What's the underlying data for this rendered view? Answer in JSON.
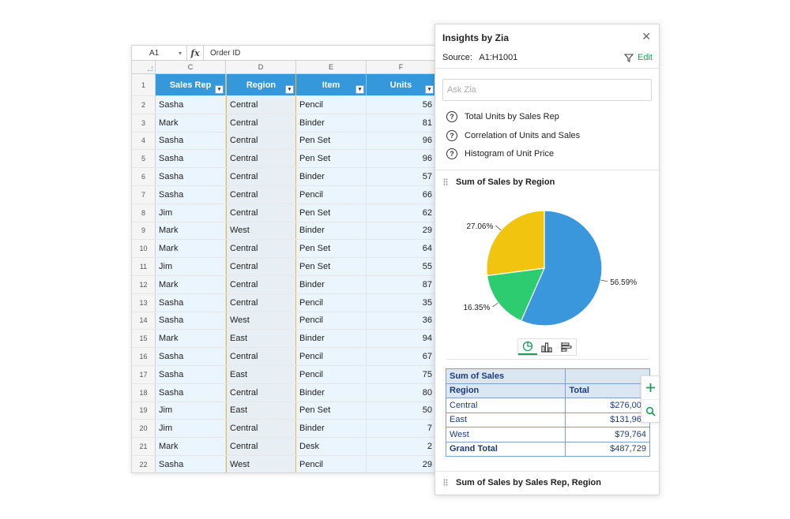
{
  "formula_bar": {
    "cell_ref": "A1",
    "fx": "fx",
    "value": "Order ID"
  },
  "columns": [
    "C",
    "D",
    "E",
    "F"
  ],
  "header_row": {
    "num": "1",
    "cells": [
      "Sales Rep",
      "Region",
      "Item",
      "Units"
    ]
  },
  "rows": [
    [
      "2",
      "Sasha",
      "Central",
      "Pencil",
      "56"
    ],
    [
      "3",
      "Mark",
      "Central",
      "Binder",
      "81"
    ],
    [
      "4",
      "Sasha",
      "Central",
      "Pen Set",
      "96"
    ],
    [
      "5",
      "Sasha",
      "Central",
      "Pen Set",
      "96"
    ],
    [
      "6",
      "Sasha",
      "Central",
      "Binder",
      "57"
    ],
    [
      "7",
      "Sasha",
      "Central",
      "Pencil",
      "66"
    ],
    [
      "8",
      "Jim",
      "Central",
      "Pen Set",
      "62"
    ],
    [
      "9",
      "Mark",
      "West",
      "Binder",
      "29"
    ],
    [
      "10",
      "Mark",
      "Central",
      "Pen Set",
      "64"
    ],
    [
      "11",
      "Jim",
      "Central",
      "Pen Set",
      "55"
    ],
    [
      "12",
      "Mark",
      "Central",
      "Binder",
      "87"
    ],
    [
      "13",
      "Sasha",
      "Central",
      "Pencil",
      "35"
    ],
    [
      "14",
      "Sasha",
      "West",
      "Pencil",
      "36"
    ],
    [
      "15",
      "Mark",
      "East",
      "Binder",
      "94"
    ],
    [
      "16",
      "Sasha",
      "Central",
      "Pencil",
      "67"
    ],
    [
      "17",
      "Sasha",
      "East",
      "Pencil",
      "75"
    ],
    [
      "18",
      "Sasha",
      "Central",
      "Binder",
      "80"
    ],
    [
      "19",
      "Jim",
      "East",
      "Pen Set",
      "50"
    ],
    [
      "20",
      "Jim",
      "Central",
      "Binder",
      "7"
    ],
    [
      "21",
      "Mark",
      "Central",
      "Desk",
      "2"
    ],
    [
      "22",
      "Sasha",
      "West",
      "Pencil",
      "29"
    ]
  ],
  "panel": {
    "title": "Insights by Zia",
    "close_icon": "close-icon",
    "source_label": "Source:",
    "source_range": "A1:H1001",
    "edit_label": "Edit",
    "ask_placeholder": "Ask Zia",
    "suggestions": [
      "Total Units by Sales Rep",
      "Correlation of Units and Sales",
      "Histogram of Unit Price"
    ],
    "card1_title": "Sum of Sales by Region",
    "card2_title": "Sum of Sales by Sales Rep, Region"
  },
  "chart_data": {
    "type": "pie",
    "slices": [
      {
        "value": 56.59,
        "label": "56.59%",
        "color": "#3b97dc"
      },
      {
        "value": 16.35,
        "label": "16.35%",
        "color": "#2ecc71"
      },
      {
        "value": 27.06,
        "label": "27.06%",
        "color": "#f1c40f"
      }
    ]
  },
  "pivot": {
    "title": "Sum of Sales",
    "col_region": "Region",
    "col_total": "Total",
    "rows": [
      {
        "region": "Central",
        "total": "$276,003"
      },
      {
        "region": "East",
        "total": "$131,962"
      },
      {
        "region": "West",
        "total": "$79,764"
      }
    ],
    "grand_label": "Grand Total",
    "grand_total": "$487,729"
  },
  "colors": {
    "header_blue": "#3498db",
    "accent_green": "#1f9c5a",
    "cell_bg": "#eaf5fd"
  }
}
